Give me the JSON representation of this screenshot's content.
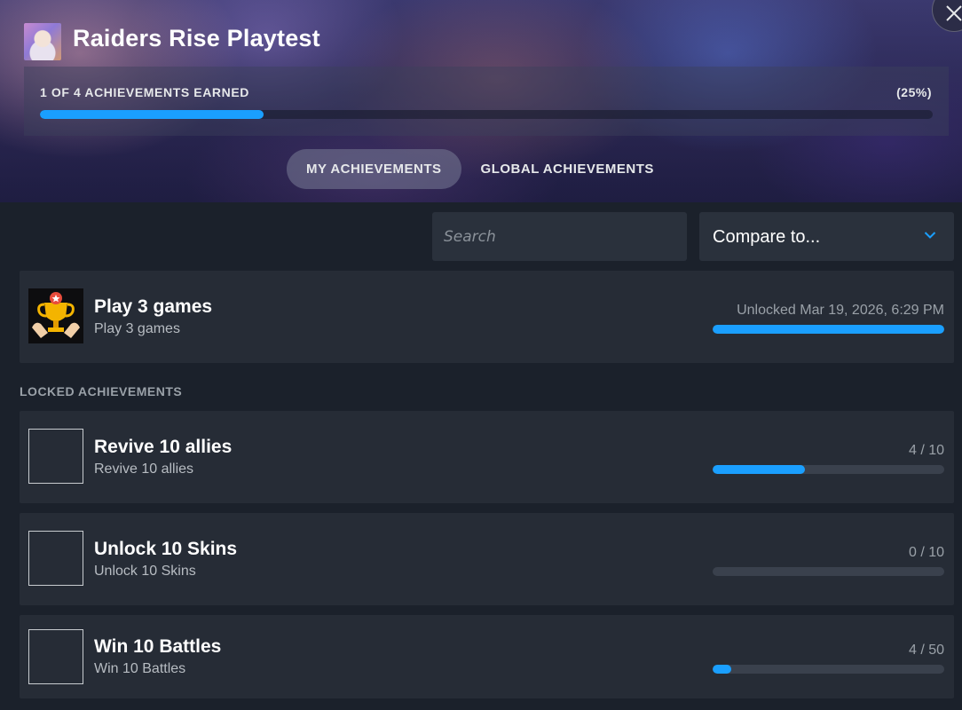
{
  "header": {
    "game_title": "Raiders Rise Playtest",
    "progress_label": "1 OF 4 ACHIEVEMENTS EARNED",
    "progress_percent_text": "(25%)",
    "progress_fraction": 0.25,
    "close_icon": "close-icon"
  },
  "tabs": [
    {
      "label": "MY ACHIEVEMENTS",
      "active": true
    },
    {
      "label": "GLOBAL ACHIEVEMENTS",
      "active": false
    }
  ],
  "filters": {
    "search_placeholder": "Search",
    "compare_label": "Compare to...",
    "compare_icon": "chevron-down-icon"
  },
  "unlocked": [
    {
      "title": "Play 3 games",
      "description": "Play 3 games",
      "status": "Unlocked Mar 19, 2026, 6:29 PM",
      "progress_fraction": 1.0,
      "icon": "trophy-icon"
    }
  ],
  "locked_heading": "LOCKED ACHIEVEMENTS",
  "locked": [
    {
      "title": "Revive 10 allies",
      "description": "Revive 10 allies",
      "status": "4 / 10",
      "progress_fraction": 0.4
    },
    {
      "title": "Unlock 10 Skins",
      "description": "Unlock 10 Skins",
      "status": "0 / 10",
      "progress_fraction": 0.0
    },
    {
      "title": "Win 10 Battles",
      "description": "Win 10 Battles",
      "status": "4 / 50",
      "progress_fraction": 0.08
    }
  ],
  "colors": {
    "accent": "#1a9fff",
    "panel": "#262c36",
    "background": "#1b212b"
  }
}
